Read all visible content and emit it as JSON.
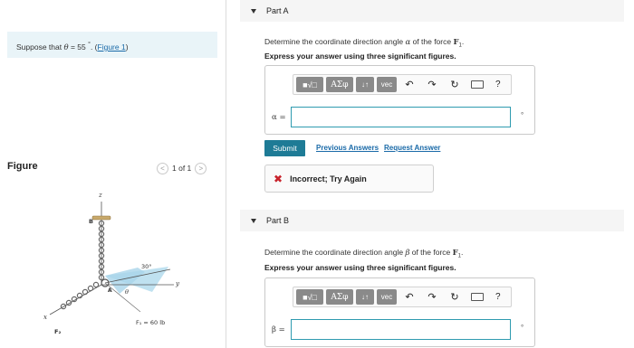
{
  "prompt": {
    "text_before": "Suppose that ",
    "theta": "θ",
    "text_mid": " = 55 ",
    "degree": "°",
    "text_after": ". (",
    "figure_link": "Figure 1",
    "close_paren": ")"
  },
  "figure": {
    "title": "Figure",
    "pager_text": "1 of 1",
    "prev_glyph": "<",
    "next_glyph": ">",
    "labels": {
      "z": "z",
      "y": "y",
      "x": "x",
      "B": "B",
      "A": "A",
      "angle30": "30°",
      "theta": "θ",
      "f1": "F₁ = 60 lb",
      "f2": "F₂"
    }
  },
  "partA": {
    "title": "Part A",
    "question_before": "Determine the coordinate direction angle ",
    "var": "α",
    "question_after": " of the force ",
    "force": "F",
    "force_sub": "1",
    "period": ".",
    "instruction": "Express your answer using three significant figures.",
    "answer_label": "α =",
    "answer_value": "",
    "unit": "°",
    "submit": "Submit",
    "prev_answers": "Previous Answers",
    "request_answer": "Request Answer",
    "feedback": "Incorrect; Try Again"
  },
  "partB": {
    "title": "Part B",
    "question_before": "Determine the coordinate direction angle ",
    "var": "β",
    "question_after": " of the force ",
    "force": "F",
    "force_sub": "1",
    "period": ".",
    "instruction": "Express your answer using three significant figures.",
    "answer_label": "β =",
    "answer_value": "",
    "unit": "°"
  },
  "toolbar": {
    "sqrt": "■√□",
    "greek": "ΑΣφ",
    "arrows": "↓↑",
    "vec": "vec",
    "undo": "↶",
    "redo": "↷",
    "reset": "↻",
    "keyboard": "▭",
    "help": "?"
  },
  "colors": {
    "accent": "#1e7b96",
    "link": "#1a6aa8",
    "prompt_bg": "#e9f4f8",
    "error": "#c8232c",
    "input_border": "#2f9bb0"
  }
}
